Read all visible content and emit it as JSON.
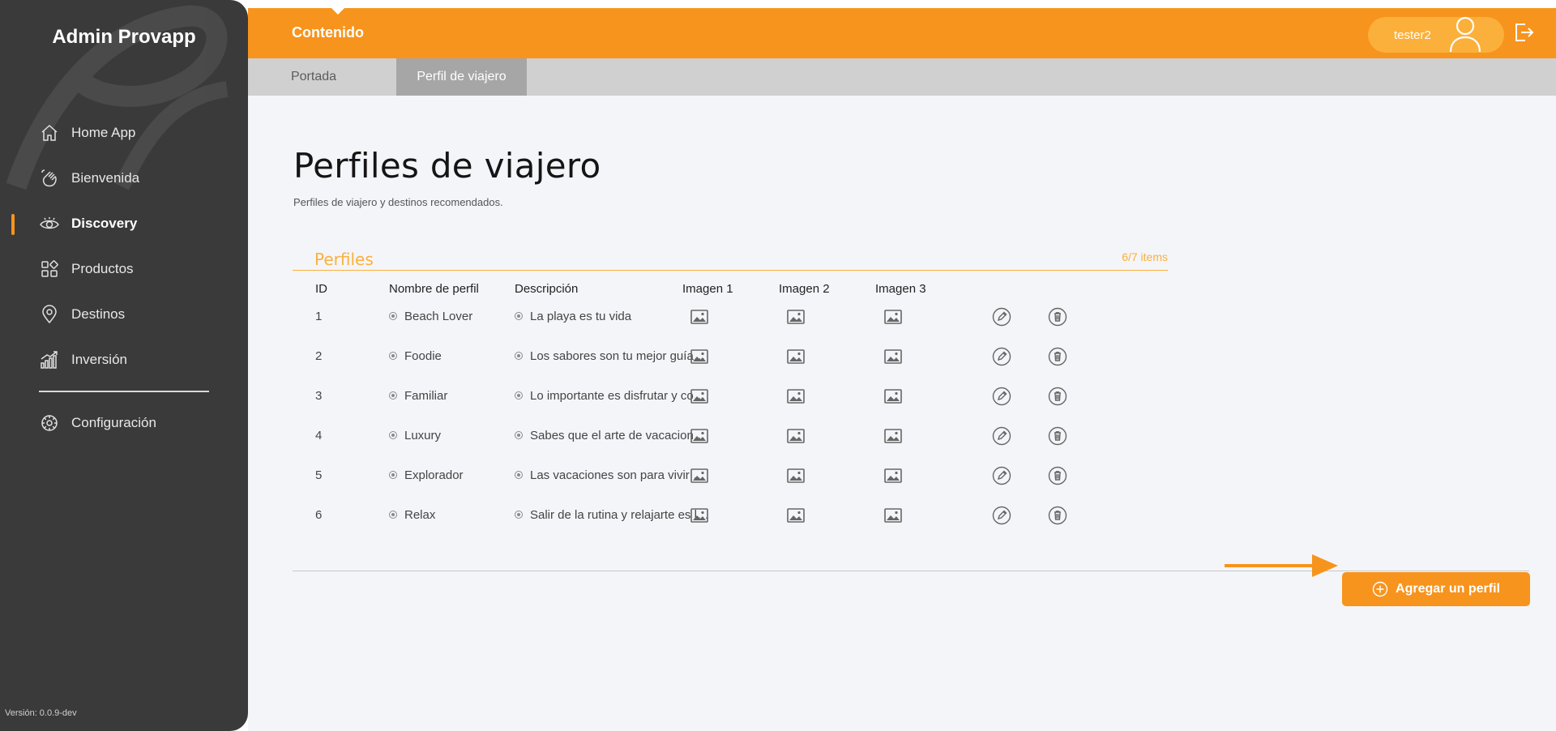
{
  "sidebar": {
    "brand": "Admin Provapp",
    "items": [
      {
        "label": "Home App",
        "icon": "home-icon"
      },
      {
        "label": "Bienvenida",
        "icon": "hand-wave-icon"
      },
      {
        "label": "Discovery",
        "icon": "eye-icon",
        "active": true
      },
      {
        "label": "Productos",
        "icon": "grid-icon"
      },
      {
        "label": "Destinos",
        "icon": "map-pin-icon"
      },
      {
        "label": "Inversión",
        "icon": "bar-chart-icon"
      }
    ],
    "settings": {
      "label": "Configuración",
      "icon": "settings-icon"
    },
    "version": "Versión: 0.0.9-dev"
  },
  "topbar": {
    "section": "Contenido",
    "user": "tester2"
  },
  "subtabs": [
    "Portada",
    "Perfil de viajero"
  ],
  "page": {
    "title": "Perfiles de viajero",
    "subtitle": "Perfiles de viajero y destinos recomendados."
  },
  "panel": {
    "title": "Perfiles",
    "count": "6/7 items",
    "columns": [
      "ID",
      "Nombre de perfil",
      "Descripción",
      "Imagen 1",
      "Imagen 2",
      "Imagen 3"
    ],
    "rows": [
      {
        "id": "1",
        "name": "Beach Lover",
        "desc": "La playa es tu vida"
      },
      {
        "id": "2",
        "name": "Foodie",
        "desc": "Los sabores son tu mejor guía…"
      },
      {
        "id": "3",
        "name": "Familiar",
        "desc": "Lo importante es disfrutar y co…"
      },
      {
        "id": "4",
        "name": "Luxury",
        "desc": "Sabes que el arte de vacacion…"
      },
      {
        "id": "5",
        "name": "Explorador",
        "desc": "Las vacaciones son para vivir …"
      },
      {
        "id": "6",
        "name": "Relax",
        "desc": "Salir de la rutina y relajarte es l…"
      }
    ]
  },
  "add_button": {
    "label": "Agregar un perfil"
  },
  "colors": {
    "accent": "#f7941d",
    "accent_light": "#fbb03b",
    "sidebar": "#3a3a3a"
  }
}
